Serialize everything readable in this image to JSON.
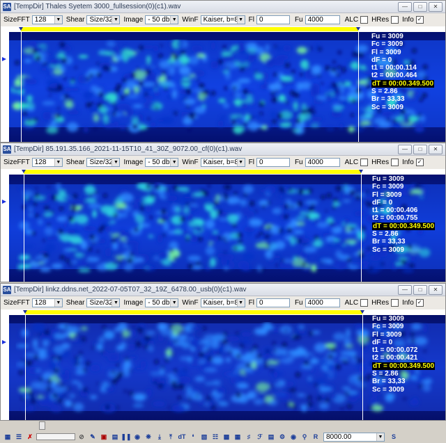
{
  "toolbar_labels": {
    "size_fft": "SizeFFT",
    "shear": "Shear",
    "image": "Image",
    "winf": "WinF",
    "fl": "Fl",
    "fu": "Fu",
    "alc": "ALC",
    "hres": "HRes",
    "info": "Info"
  },
  "windows": [
    {
      "title": "[TempDir] Thales Syetem 3000_fullsession(0)(c1).wav",
      "size_fft": "128",
      "shear": "Size/32",
      "image": "- 50 db",
      "winf": "Kaiser, b=8",
      "fl_value": "0",
      "fu_value": "4000",
      "alc_checked": false,
      "hres_checked": false,
      "info_checked": true,
      "info_lines": {
        "fu": "Fu = 3009",
        "fc": "Fc = 3009",
        "fl": "Fl = 3009",
        "df": "dF = 0",
        "t1": "t1 = 00:00.114",
        "t2": "t2 = 00:00.464",
        "dt": "dT = 00:00.349.500",
        "s": "S = 2.86",
        "br": "Br = 33,33",
        "sc": "Sc = 3009"
      }
    },
    {
      "title": "[TempDir] 85.191.35.166_2021-11-15T10_41_30Z_9072.00_cf(0)(c1).wav",
      "size_fft": "128",
      "shear": "Size/32",
      "image": "- 50 db",
      "winf": "Kaiser, b=8",
      "fl_value": "0",
      "fu_value": "4000",
      "alc_checked": false,
      "hres_checked": false,
      "info_checked": true,
      "info_lines": {
        "fu": "Fu = 3009",
        "fc": "Fc = 3009",
        "fl": "Fl = 3009",
        "df": "dF = 0",
        "t1": "t1 = 00:00.406",
        "t2": "t2 = 00:00.755",
        "dt": "dT = 00:00.349.500",
        "s": "S = 2.86",
        "br": "Br = 33,33",
        "sc": "Sc = 3009"
      }
    },
    {
      "title": "[TempDir] linkz.ddns.net_2022-07-05T07_32_19Z_6478.00_usb(0)(c1).wav",
      "size_fft": "128",
      "shear": "Size/32",
      "image": "- 50 db",
      "winf": "Kaiser, b=8",
      "fl_value": "0",
      "fu_value": "4000",
      "alc_checked": false,
      "hres_checked": false,
      "info_checked": true,
      "info_lines": {
        "fu": "Fu = 3009",
        "fc": "Fc = 3009",
        "fl": "Fl = 3009",
        "df": "dF = 0",
        "t1": "t1 = 00:00.072",
        "t2": "t2 = 00:00.421",
        "dt": "dT = 00:00.349.500",
        "s": "S = 2.86",
        "br": "Br = 33,33",
        "sc": "Sc = 3009"
      }
    }
  ],
  "bottom": {
    "frequency_value": "8000.00",
    "s_label": "S",
    "r_label": "R",
    "dt_label": "dT"
  },
  "colors": {
    "spectrogram_dark": "#05127a",
    "spectrogram_mid": "#1a5cff",
    "spectrogram_bright": "#3ff0c8",
    "highlight": "#ffff00",
    "marker_bar": "#ffff00"
  }
}
